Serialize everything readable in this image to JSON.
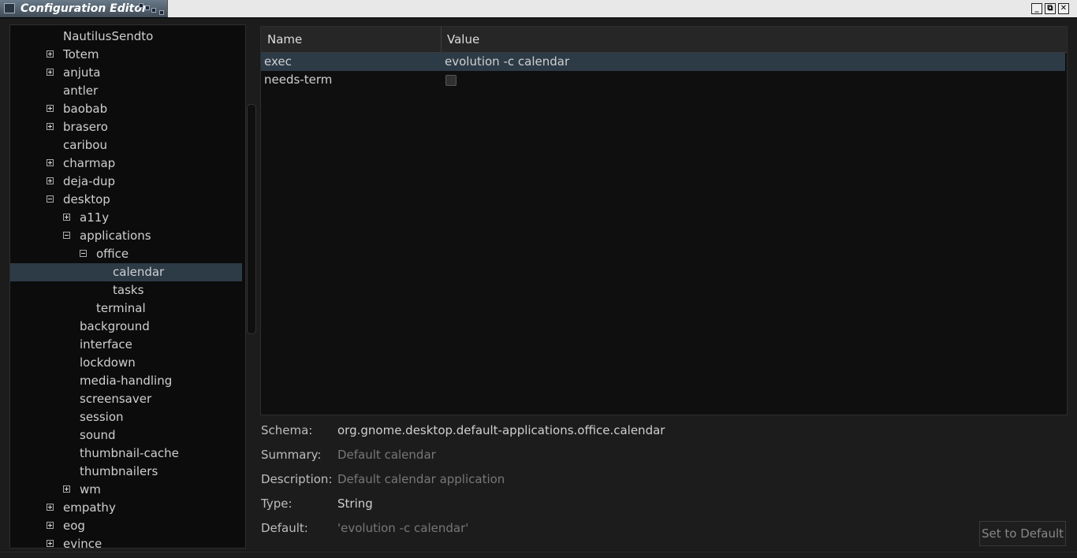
{
  "window": {
    "title": "Configuration Editor",
    "controls": [
      "minimize-icon",
      "maximize-icon",
      "close-icon"
    ]
  },
  "tree": {
    "selected": "calendar",
    "items": [
      {
        "label": "NautilusSendto",
        "depth": 0,
        "expander": "none"
      },
      {
        "label": "Totem",
        "depth": 0,
        "expander": "plus"
      },
      {
        "label": "anjuta",
        "depth": 0,
        "expander": "plus"
      },
      {
        "label": "antler",
        "depth": 0,
        "expander": "none"
      },
      {
        "label": "baobab",
        "depth": 0,
        "expander": "plus"
      },
      {
        "label": "brasero",
        "depth": 0,
        "expander": "plus"
      },
      {
        "label": "caribou",
        "depth": 0,
        "expander": "none"
      },
      {
        "label": "charmap",
        "depth": 0,
        "expander": "plus"
      },
      {
        "label": "deja-dup",
        "depth": 0,
        "expander": "plus"
      },
      {
        "label": "desktop",
        "depth": 0,
        "expander": "minus"
      },
      {
        "label": "a11y",
        "depth": 1,
        "expander": "plus"
      },
      {
        "label": "applications",
        "depth": 1,
        "expander": "minus"
      },
      {
        "label": "office",
        "depth": 2,
        "expander": "minus"
      },
      {
        "label": "calendar",
        "depth": 3,
        "expander": "none",
        "selected": true
      },
      {
        "label": "tasks",
        "depth": 3,
        "expander": "none"
      },
      {
        "label": "terminal",
        "depth": 2,
        "expander": "none"
      },
      {
        "label": "background",
        "depth": 1,
        "expander": "none"
      },
      {
        "label": "interface",
        "depth": 1,
        "expander": "none"
      },
      {
        "label": "lockdown",
        "depth": 1,
        "expander": "none"
      },
      {
        "label": "media-handling",
        "depth": 1,
        "expander": "none"
      },
      {
        "label": "screensaver",
        "depth": 1,
        "expander": "none"
      },
      {
        "label": "session",
        "depth": 1,
        "expander": "none"
      },
      {
        "label": "sound",
        "depth": 1,
        "expander": "none"
      },
      {
        "label": "thumbnail-cache",
        "depth": 1,
        "expander": "none"
      },
      {
        "label": "thumbnailers",
        "depth": 1,
        "expander": "none"
      },
      {
        "label": "wm",
        "depth": 1,
        "expander": "plus"
      },
      {
        "label": "empathy",
        "depth": 0,
        "expander": "plus"
      },
      {
        "label": "eog",
        "depth": 0,
        "expander": "plus"
      },
      {
        "label": "evince",
        "depth": 0,
        "expander": "plus"
      }
    ]
  },
  "keys": {
    "columns": {
      "name": "Name",
      "value": "Value"
    },
    "rows": [
      {
        "name": "exec",
        "value": "evolution -c calendar",
        "selected": true
      },
      {
        "name": "needs-term",
        "value": "",
        "checkbox": false
      }
    ]
  },
  "details": {
    "schema_label": "Schema:",
    "schema_value": "org.gnome.desktop.default-applications.office.calendar",
    "summary_label": "Summary:",
    "summary_value": "Default calendar",
    "description_label": "Description:",
    "description_value": "Default calendar application",
    "type_label": "Type:",
    "type_value": "String",
    "default_label": "Default:",
    "default_value": "'evolution -c calendar'",
    "set_default_label": "Set to Default"
  },
  "colors": {
    "selection": "#2d3b47",
    "background": "#1c1c1c"
  }
}
